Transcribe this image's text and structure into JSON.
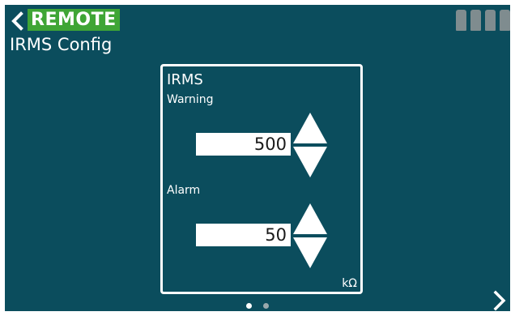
{
  "header": {
    "mode_badge": "REMOTE",
    "title": "IRMS Config",
    "status_bar_count": 4
  },
  "panel": {
    "title": "IRMS",
    "warning": {
      "label": "Warning",
      "value": "500"
    },
    "alarm": {
      "label": "Alarm",
      "value": "50"
    },
    "unit": "kΩ"
  },
  "pagination": {
    "current_page": 1,
    "total_pages": 2
  },
  "colors": {
    "background": "#0b4d5d",
    "badge": "#3fa535",
    "status_block": "#7f8c8f"
  },
  "icons": {
    "back": "chevron-left-icon",
    "next": "chevron-right-icon",
    "increment": "triangle-up-icon",
    "decrement": "triangle-down-icon"
  }
}
